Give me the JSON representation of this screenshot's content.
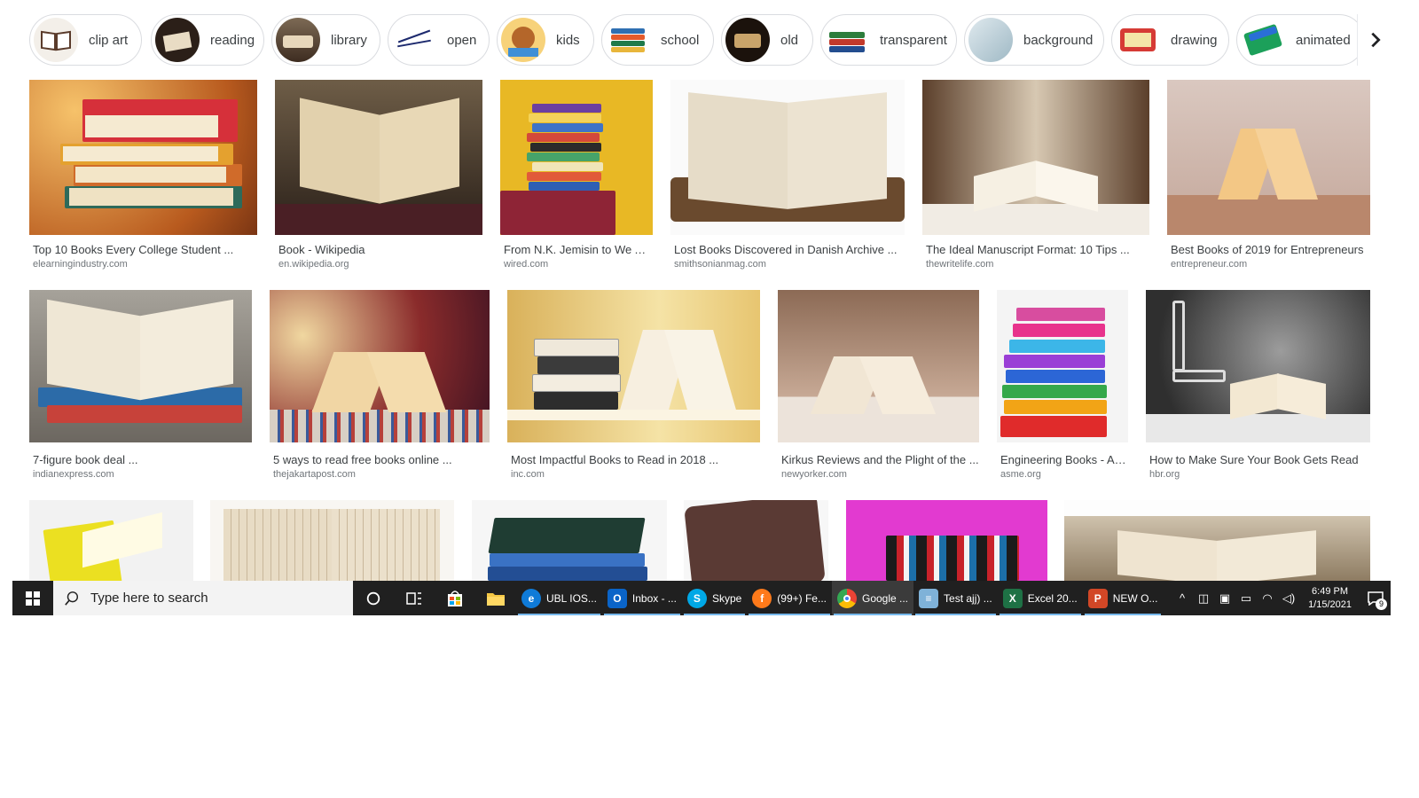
{
  "chips": [
    {
      "label": "clip art",
      "thumb": "clip-art"
    },
    {
      "label": "reading",
      "thumb": "reading"
    },
    {
      "label": "library",
      "thumb": "library"
    },
    {
      "label": "open",
      "thumb": "open"
    },
    {
      "label": "kids",
      "thumb": "kids"
    },
    {
      "label": "school",
      "thumb": "school"
    },
    {
      "label": "old",
      "thumb": "old"
    },
    {
      "label": "transparent",
      "thumb": "transparent"
    },
    {
      "label": "background",
      "thumb": "background"
    },
    {
      "label": "drawing",
      "thumb": "drawing"
    },
    {
      "label": "animated",
      "thumb": "animated"
    }
  ],
  "next_icon": "chevron-right-icon",
  "results": [
    {
      "title": "Top 10 Books Every College Student ...",
      "site": "elearningindustry.com"
    },
    {
      "title": "Book - Wikipedia",
      "site": "en.wikipedia.org"
    },
    {
      "title": "From N.K. Jemisin to We Are...",
      "site": "wired.com"
    },
    {
      "title": "Lost Books Discovered in Danish Archive ...",
      "site": "smithsonianmag.com"
    },
    {
      "title": "The Ideal Manuscript Format: 10 Tips ...",
      "site": "thewritelife.com"
    },
    {
      "title": "Best Books of 2019 for Entrepreneurs",
      "site": "entrepreneur.com"
    },
    {
      "title": "7-figure book deal ...",
      "site": "indianexpress.com"
    },
    {
      "title": "5 ways to read free books online ...",
      "site": "thejakartapost.com"
    },
    {
      "title": "Most Impactful Books to Read in 2018 ...",
      "site": "inc.com"
    },
    {
      "title": "Kirkus Reviews and the Plight of the ...",
      "site": "newyorker.com"
    },
    {
      "title": "Engineering Books - AS...",
      "site": "asme.org"
    },
    {
      "title": "How to Make Sure Your Book Gets Read",
      "site": "hbr.org"
    }
  ],
  "taskbar": {
    "search_placeholder": "Type here to search",
    "apps": [
      {
        "label": "UBL IOS...",
        "icon": "edge-icon",
        "color": "#0f7bd8"
      },
      {
        "label": "Inbox - ...",
        "icon": "outlook-icon",
        "color": "#0a64c8"
      },
      {
        "label": "Skype",
        "icon": "skype-icon",
        "color": "#00a8e6"
      },
      {
        "label": "(99+) Fe...",
        "icon": "firefox-icon",
        "color": "#ff7a1a"
      },
      {
        "label": "Google ...",
        "icon": "chrome-icon",
        "color": "#4285f4"
      },
      {
        "label": "Test ajj) ...",
        "icon": "notepad-icon",
        "color": "#7fb2d8"
      },
      {
        "label": "Excel 20...",
        "icon": "excel-icon",
        "color": "#1e7145"
      },
      {
        "label": "NEW O...",
        "icon": "powerpoint-icon",
        "color": "#d24726"
      }
    ],
    "time": "6:49 PM",
    "date": "1/15/2021",
    "notification_count": "9"
  }
}
